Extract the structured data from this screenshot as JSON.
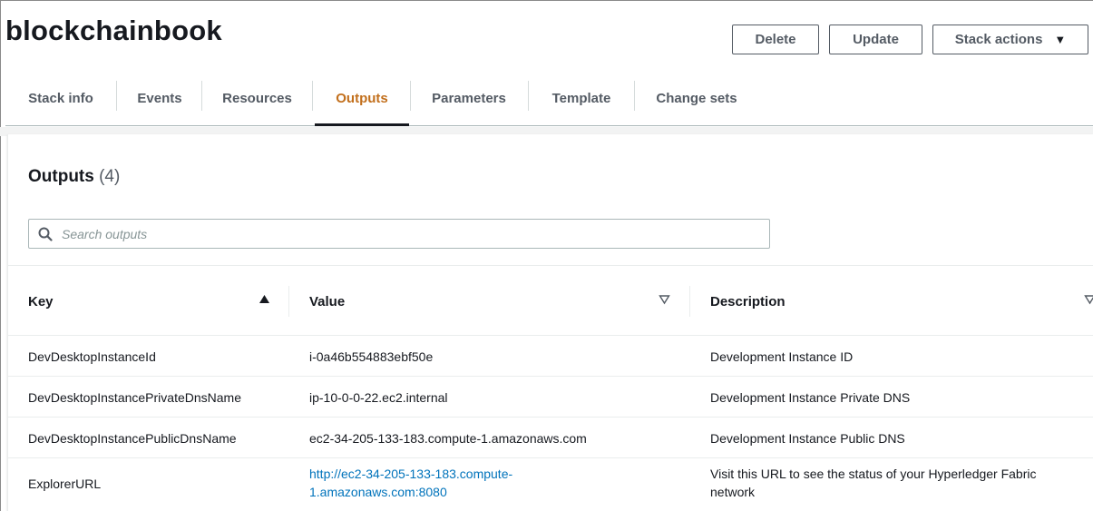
{
  "stack": {
    "name": "blockchainbook"
  },
  "actions": {
    "delete_label": "Delete",
    "update_label": "Update",
    "stack_actions_label": "Stack actions"
  },
  "tabs": [
    {
      "label": "Stack info"
    },
    {
      "label": "Events"
    },
    {
      "label": "Resources"
    },
    {
      "label": "Outputs",
      "active": true
    },
    {
      "label": "Parameters"
    },
    {
      "label": "Template"
    },
    {
      "label": "Change sets"
    }
  ],
  "outputs": {
    "title": "Outputs",
    "count": "(4)",
    "search_placeholder": "Search outputs",
    "columns": {
      "key": "Key",
      "value": "Value",
      "description": "Description"
    },
    "sort": {
      "column": "Key",
      "direction": "ascending"
    },
    "rows": [
      {
        "key": "DevDesktopInstanceId",
        "value": "i-0a46b554883ebf50e",
        "description": "Development Instance ID"
      },
      {
        "key": "DevDesktopInstancePrivateDnsName",
        "value": "ip-10-0-0-22.ec2.internal",
        "description": "Development Instance Private DNS"
      },
      {
        "key": "DevDesktopInstancePublicDnsName",
        "value": "ec2-34-205-133-183.compute-1.amazonaws.com",
        "description": "Development Instance Public DNS"
      },
      {
        "key": "ExplorerURL",
        "value_line1": "http://ec2-34-205-133-183.compute-",
        "value_line2": "1.amazonaws.com:8080",
        "description_line1": "Visit this URL to see the status of your Hyperledger Fabric",
        "description_line2": "network"
      }
    ]
  },
  "colors": {
    "active_tab": "#c26f1c",
    "link": "#0073bb",
    "text": "#16191f",
    "muted": "#545b64"
  },
  "icons": {
    "search": "search-icon",
    "caret": "caret-down-icon",
    "sort_asc": "sort-ascending-icon",
    "sort_none": "sort-icon"
  }
}
